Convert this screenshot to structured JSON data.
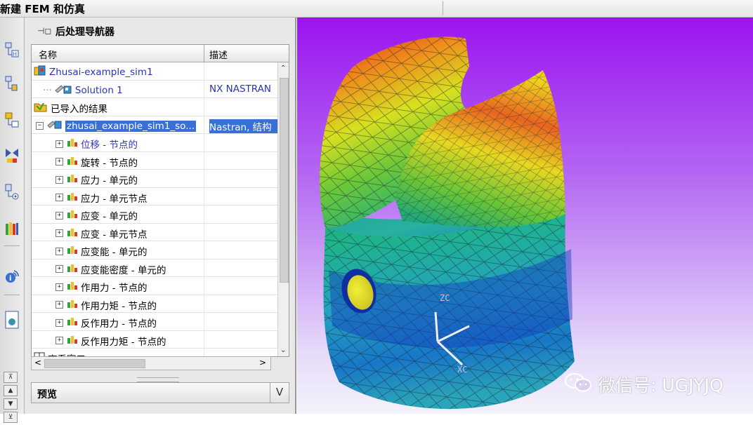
{
  "window": {
    "title": "新建 FEM 和仿真"
  },
  "navigator": {
    "title": "后处理导航器",
    "columns": {
      "name": "名称",
      "description": "描述"
    },
    "rows": [
      {
        "label": "Zhusai-example_sim1",
        "desc": "",
        "style": "blue",
        "icon": "sim-file-icon"
      },
      {
        "label": "Solution 1",
        "desc": "NX NASTRAN",
        "style": "blue",
        "icon": "solution-icon"
      },
      {
        "label": "已导入的结果",
        "desc": "",
        "style": "normal",
        "icon": "imported-results-folder-icon"
      },
      {
        "label": "zhusai_example_sim1_so...",
        "desc": "Nastran, 结构",
        "style": "selected",
        "icon": "result-file-icon"
      },
      {
        "label": "位移 - 节点的",
        "desc": "",
        "style": "blue",
        "icon": "result-set-icon"
      },
      {
        "label": "旋转 - 节点的",
        "desc": "",
        "style": "normal",
        "icon": "result-set-icon"
      },
      {
        "label": "应力 - 单元的",
        "desc": "",
        "style": "normal",
        "icon": "result-set-icon"
      },
      {
        "label": "应力 - 单元节点",
        "desc": "",
        "style": "normal",
        "icon": "result-set-icon"
      },
      {
        "label": "应变 - 单元的",
        "desc": "",
        "style": "normal",
        "icon": "result-set-icon"
      },
      {
        "label": "应变 - 单元节点",
        "desc": "",
        "style": "normal",
        "icon": "result-set-icon"
      },
      {
        "label": "应变能 - 单元的",
        "desc": "",
        "style": "normal",
        "icon": "result-set-icon"
      },
      {
        "label": "应变能密度 - 单元的",
        "desc": "",
        "style": "normal",
        "icon": "result-set-icon"
      },
      {
        "label": "作用力 - 节点的",
        "desc": "",
        "style": "normal",
        "icon": "result-set-icon"
      },
      {
        "label": "作用力矩 - 节点的",
        "desc": "",
        "style": "normal",
        "icon": "result-set-icon"
      },
      {
        "label": "反作用力 - 节点的",
        "desc": "",
        "style": "normal",
        "icon": "result-set-icon"
      },
      {
        "label": "反作用力矩 - 节点的",
        "desc": "",
        "style": "normal",
        "icon": "result-set-icon"
      },
      {
        "label": "查看窗口",
        "desc": "",
        "style": "normal",
        "icon": "viewport-grid-icon"
      }
    ],
    "preview": {
      "label": "预览",
      "toggle": "V"
    }
  },
  "viewport": {
    "watermark": "微信号: UGJYJQ",
    "axis_labels": {
      "z": "ZC",
      "x": "XC"
    }
  }
}
